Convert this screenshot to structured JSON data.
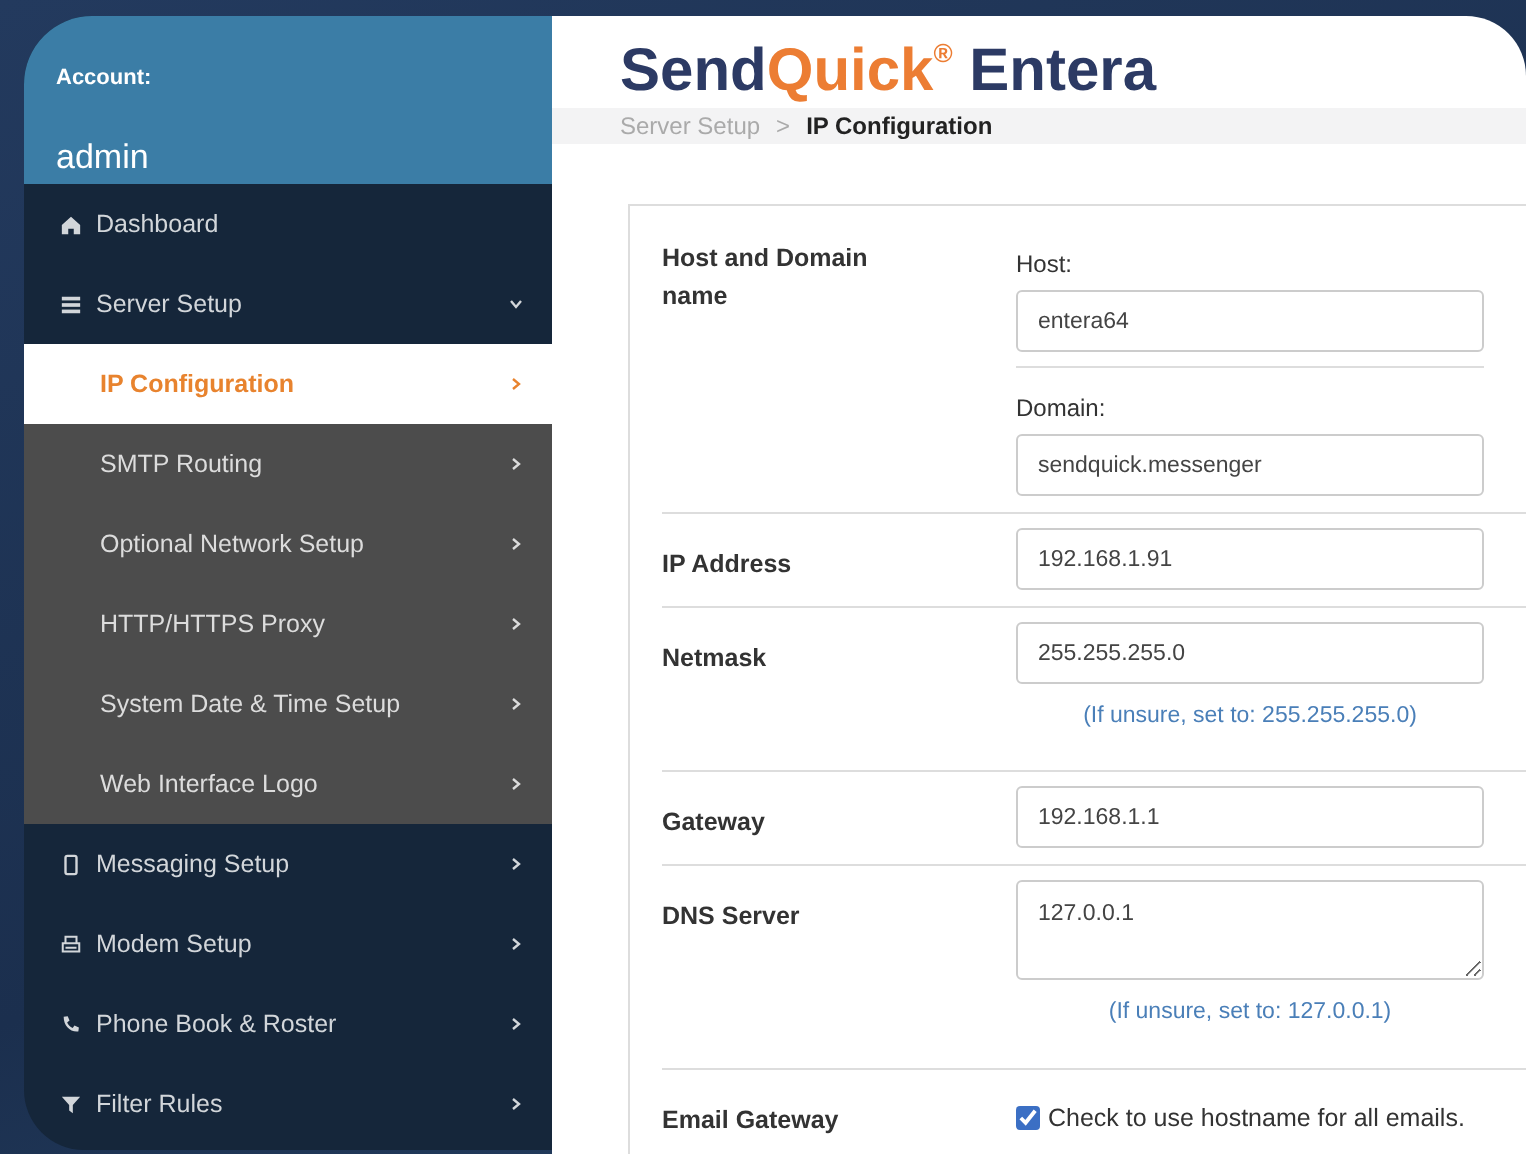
{
  "sidebar": {
    "account_label": "Account:",
    "account_name": "admin",
    "items": [
      {
        "label": "Dashboard",
        "kind": "home",
        "selected": false
      },
      {
        "label": "Server Setup",
        "kind": "list",
        "selected": false,
        "expanded": true,
        "children": [
          {
            "label": "IP Configuration",
            "selected": true
          },
          {
            "label": "SMTP Routing",
            "selected": false
          },
          {
            "label": "Optional Network Setup",
            "selected": false
          },
          {
            "label": "HTTP/HTTPS Proxy",
            "selected": false
          },
          {
            "label": "System Date & Time Setup",
            "selected": false
          },
          {
            "label": "Web Interface Logo",
            "selected": false
          }
        ]
      },
      {
        "label": "Messaging Setup",
        "kind": "mobile",
        "selected": false,
        "expanded": false
      },
      {
        "label": "Modem Setup",
        "kind": "printer",
        "selected": false,
        "expanded": false
      },
      {
        "label": "Phone Book & Roster",
        "kind": "phone",
        "selected": false,
        "expanded": false
      },
      {
        "label": "Filter Rules",
        "kind": "filter",
        "selected": false,
        "expanded": false
      }
    ]
  },
  "logo": {
    "brand_start": "Send",
    "brand_accent": "Quick",
    "registered": "®",
    "product": "Entera"
  },
  "breadcrumb": [
    {
      "label": "Server Setup",
      "current": false
    },
    {
      "separator": ">"
    },
    {
      "label": "IP Configuration",
      "current": true
    }
  ],
  "form": {
    "rows": [
      {
        "kind": "fields",
        "label": "Host and Domain name",
        "fields": [
          {
            "label": "Host:",
            "value": "entera64",
            "kind": "input"
          },
          {
            "label": "Domain:",
            "value": "sendquick.messenger",
            "kind": "input"
          }
        ]
      },
      {
        "kind": "fields",
        "label": "IP Address",
        "fields": [
          {
            "value": "192.168.1.91",
            "kind": "input"
          }
        ]
      },
      {
        "kind": "fields",
        "label": "Netmask",
        "fields": [
          {
            "value": "255.255.255.0",
            "kind": "input"
          }
        ],
        "hint": "(If unsure, set to: 255.255.255.0)"
      },
      {
        "kind": "fields",
        "label": "Gateway",
        "fields": [
          {
            "value": "192.168.1.1",
            "kind": "input"
          }
        ]
      },
      {
        "kind": "fields",
        "label": "DNS Server",
        "fields": [
          {
            "value": "127.0.0.1",
            "kind": "textarea"
          }
        ],
        "hint": "(If unsure, set to: 127.0.0.1)"
      },
      {
        "kind": "checkbox",
        "label": "Email Gateway",
        "checked": true,
        "text": "Check to use hostname for all emails."
      }
    ]
  }
}
